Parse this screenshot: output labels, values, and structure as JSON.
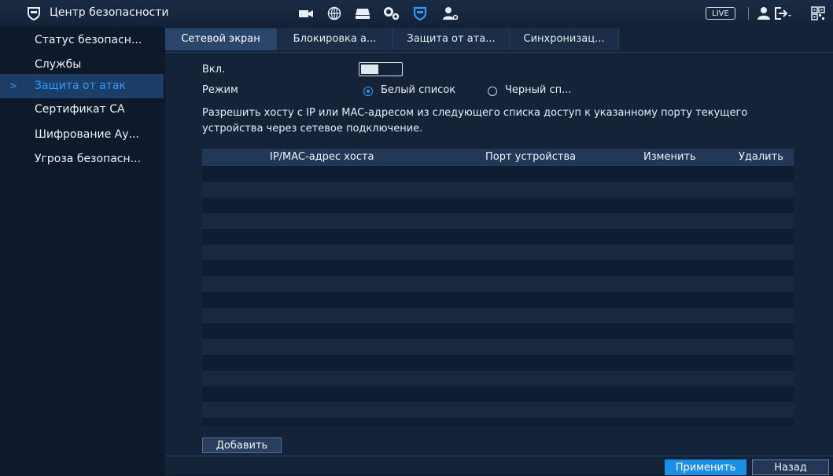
{
  "app": {
    "title": "Центр безопасности"
  },
  "topbar": {
    "icons": [
      "shield-icon",
      "camera-icon",
      "network-globe-icon",
      "storage-icon",
      "settings-gears-icon",
      "security-shield-icon",
      "account-settings-icon"
    ],
    "live_label": "LIVE",
    "right_icons": [
      "user-icon",
      "logout-icon",
      "qr-code-icon"
    ],
    "accent_color": "#2d9cff"
  },
  "sidebar": {
    "items": [
      {
        "label": "Статус безопасн...",
        "active": false
      },
      {
        "label": "Службы",
        "active": false
      },
      {
        "label": "Защита от атак",
        "active": true
      },
      {
        "label": "Сертификат CA",
        "active": false
      },
      {
        "label": "Шифрование Ау...",
        "active": false
      },
      {
        "label": "Угроза безопасн...",
        "active": false
      }
    ],
    "active_arrow": ">"
  },
  "tabs": [
    {
      "label": "Сетевой экран",
      "active": true
    },
    {
      "label": "Блокировка а...",
      "active": false
    },
    {
      "label": "Защита от ата...",
      "active": false
    },
    {
      "label": "Синхронизац...",
      "active": false
    }
  ],
  "form": {
    "enable_label": "Вкл.",
    "enable_on": true,
    "mode_label": "Режим",
    "mode_options": [
      {
        "label": "Белый список",
        "selected": true
      },
      {
        "label": "Черный сп...",
        "selected": false
      }
    ],
    "description": "Разрешить хосту с IP или MAC-адресом из следующего списка доступ к указанному порту текущего устройства через сетевое подключение."
  },
  "table": {
    "columns": [
      "IP/MAC-адрес хоста",
      "Порт устройства",
      "Изменить",
      "Удалить"
    ],
    "rows": []
  },
  "buttons": {
    "add": "Добавить",
    "apply": "Применить",
    "back": "Назад"
  }
}
